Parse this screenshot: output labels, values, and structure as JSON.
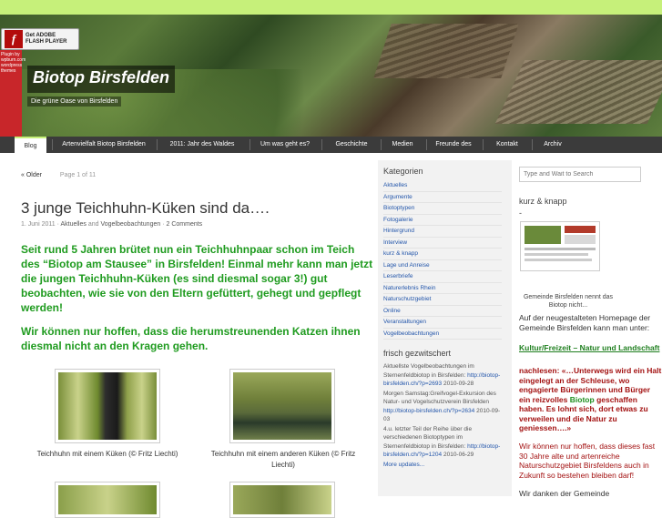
{
  "flash": {
    "line1": "Get ADOBE",
    "line2": "FLASH PLAYER",
    "glyph": "f"
  },
  "plugin_text": "Plugin by wpburn.com wordpress themes",
  "site": {
    "title": "Biotop Birsfelden",
    "tagline": "Die grüne Oase von Birsfelden"
  },
  "nav": [
    "Blog",
    "Artenvielfalt Biotop Birsfelden",
    "2011: Jahr des Waldes",
    "Um was geht es?",
    "Geschichte",
    "Medien",
    "Freunde des",
    "Kontakt",
    "Archiv"
  ],
  "pager": {
    "older": "« Older",
    "info": "Page 1 of 11"
  },
  "post": {
    "title": "3 junge Teichhuhn-Küken sind da….",
    "date": "1. Juni 2011",
    "cat1": "Aktuelles",
    "and": "and",
    "cat2": "Vogelbeobachtungen",
    "comments": "2 Comments",
    "p1": "Seit rund 5 Jahren brütet nun ein Teichhuhnpaar schon im Teich des “Biotop am Stausee” in Birsfelden! Einmal mehr kann man jetzt die jungen Teichhuhn-Küken (es sind diesmal sogar 3!) gut beobachten, wie sie von den Eltern gefüttert, gehegt und gepflegt werden!",
    "p2": "Wir können nur hoffen, dass die herumstreunenden Katzen ihnen diesmal nicht an den Kragen gehen.",
    "caption1": "Teichhuhn mit einem Küken (© Fritz Liechti)",
    "caption2": "Teichhuhn mit einem anderen Küken (© Fritz Liechti)"
  },
  "categories": {
    "heading": "Kategorien",
    "items": [
      "Aktuelles",
      "Argumente",
      "Biotoptypen",
      "Fotogalerie",
      "Hintergrund",
      "Interview",
      "kurz & knapp",
      "Lage und Anreise",
      "Leserbriefe",
      "Naturerlebnis Rhein",
      "Naturschutzgebiet",
      "Online",
      "Veranstaltungen",
      "Vogelbeobachtungen"
    ]
  },
  "news": {
    "heading": "frisch gezwitschert",
    "items": [
      {
        "text": "Aktuellste Vogelbeobachtungen im Sternenfeldbiotop in Birsfelden:",
        "url": "http://biotop-birsfelden.ch/?p=2693",
        "date": "2010-09-28"
      },
      {
        "text": "Morgen Samstag:Greifvogel-Exkursion des Natur- und Vogelschutzverein Birsfelden",
        "url": "http://biotop-birsfelden.ch/?p=2634",
        "date": "2010-09-03"
      },
      {
        "text": "4.u. letzter Teil der Reihe über die verschiedenen Biotoptypen im Sternenfeldbiotop in Birsfelden:",
        "url": "http://biotop-birsfelden.ch/?p=1204",
        "date": "2010-06-29"
      }
    ],
    "more": "More updates..."
  },
  "search": {
    "placeholder": "Type and Wait to Search"
  },
  "kurz": {
    "title": "kurz & knapp",
    "dash": "-",
    "thumb_caption": "Gemeinde Birsfelden nennt das Biotop nicht...",
    "intro": "Auf der neugestalteten Homepage der Gemeinde Birsfelden kann man unter:",
    "link": "Kultur/Freizeit – Natur und Landschaft",
    "lead": "nachlesen: «…Unterwegs wird ein Halt eingelegt an der Schleuse, wo engagierte Bürgerinnen und Bürger ein reizvolles",
    "biotop": "Biotop",
    "tail": "geschaffen haben. Es lohnt sich, dort etwas zu verweilen und die Natur zu geniessen….»",
    "p2": "Wir können nur hoffen, dass dieses fast 30 Jahre alte und artenreiche Naturschutzgebiet Birsfeldens auch in Zukunft so bestehen bleiben darf!",
    "p3": "Wir danken der Gemeinde"
  },
  "colors": {
    "accent": "#c6f07a",
    "green_text": "#1f9b1f",
    "nav_bg": "#3b3b3b",
    "link": "#2255aa"
  }
}
